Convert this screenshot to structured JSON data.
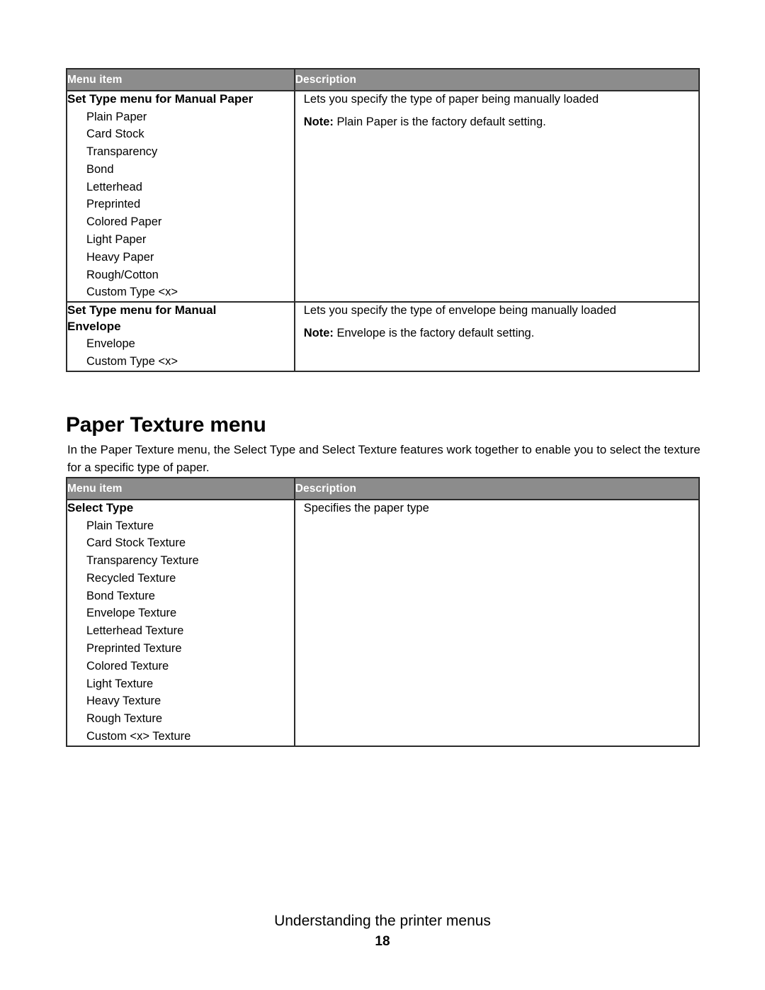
{
  "page": {
    "footer_title": "Understanding the printer menus",
    "page_number": "18"
  },
  "colors": {
    "table_header_bg": "#8c8c8c",
    "table_header_text": "#ffffff",
    "table_border": "#2b2b2b",
    "page_bg": "#ffffff",
    "body_text": "#000000"
  },
  "table_set_type": {
    "columns": [
      "Menu item",
      "Description"
    ],
    "rows": [
      {
        "title": "Set Type menu for Manual Paper",
        "options": [
          "Plain Paper",
          "Card Stock",
          "Transparency",
          "Bond",
          "Letterhead",
          "Preprinted",
          "Colored Paper",
          "Light Paper",
          "Heavy Paper",
          "Rough/Cotton",
          "Custom Type <x>"
        ],
        "description": "Lets you specify the type of paper being manually loaded",
        "note_label": "Note:",
        "note_text": "Plain Paper is the factory default setting."
      },
      {
        "title": "Set Type menu for Manual Envelope",
        "options": [
          "Envelope",
          "Custom Type <x>"
        ],
        "description": "Lets you specify the type of envelope being manually loaded",
        "note_label": "Note:",
        "note_text": "Envelope is the factory default setting."
      }
    ]
  },
  "section": {
    "heading": "Paper Texture menu",
    "paragraph": "In the Paper Texture menu, the Select Type and Select Texture features work together to enable you to select the texture for a specific type of paper."
  },
  "table_paper_texture": {
    "columns": [
      "Menu item",
      "Description"
    ],
    "rows": [
      {
        "title": "Select Type",
        "options": [
          "Plain Texture",
          "Card Stock Texture",
          "Transparency Texture",
          "Recycled Texture",
          "Bond Texture",
          "Envelope Texture",
          "Letterhead Texture",
          "Preprinted Texture",
          "Colored Texture",
          "Light Texture",
          "Heavy Texture",
          "Rough Texture",
          "Custom <x> Texture"
        ],
        "description": "Specifies the paper type"
      }
    ]
  }
}
